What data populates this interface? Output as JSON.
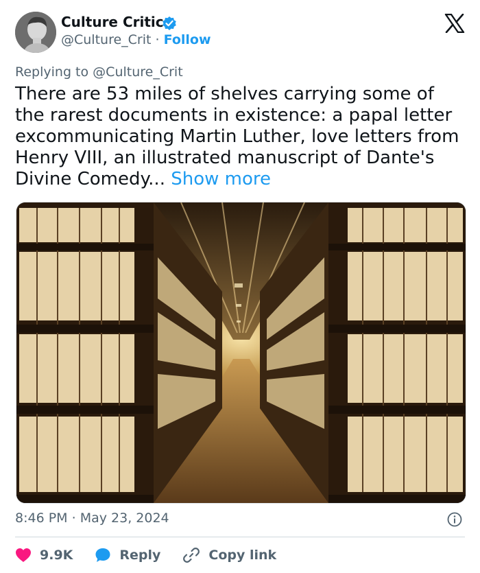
{
  "author": {
    "name": "Culture Critic",
    "handle": "@Culture_Crit",
    "separator": "·",
    "follow_label": "Follow"
  },
  "reply_context": {
    "prefix": "Replying to",
    "target": "@Culture_Crit"
  },
  "post": {
    "text": "There are 53 miles of shelves carrying some of the rarest documents in existence: a papal letter excommunicating Martin Luther, love letters from Henry VIII, an illustrated manuscript of Dante's Divine Comedy...",
    "show_more": "Show more"
  },
  "meta": {
    "time": "8:46 PM",
    "separator": "·",
    "date": "May 23, 2024"
  },
  "actions": {
    "likes": "9.9K",
    "reply": "Reply",
    "copy_link": "Copy link"
  },
  "colors": {
    "accent": "#1d9bf0",
    "like": "#f91880",
    "muted": "#536471",
    "text": "#0f1419"
  },
  "icons": {
    "verified": "verified-badge-icon",
    "platform": "x-logo-icon",
    "info": "info-icon",
    "like": "heart-icon",
    "reply": "speech-bubble-icon",
    "copy": "link-icon"
  }
}
